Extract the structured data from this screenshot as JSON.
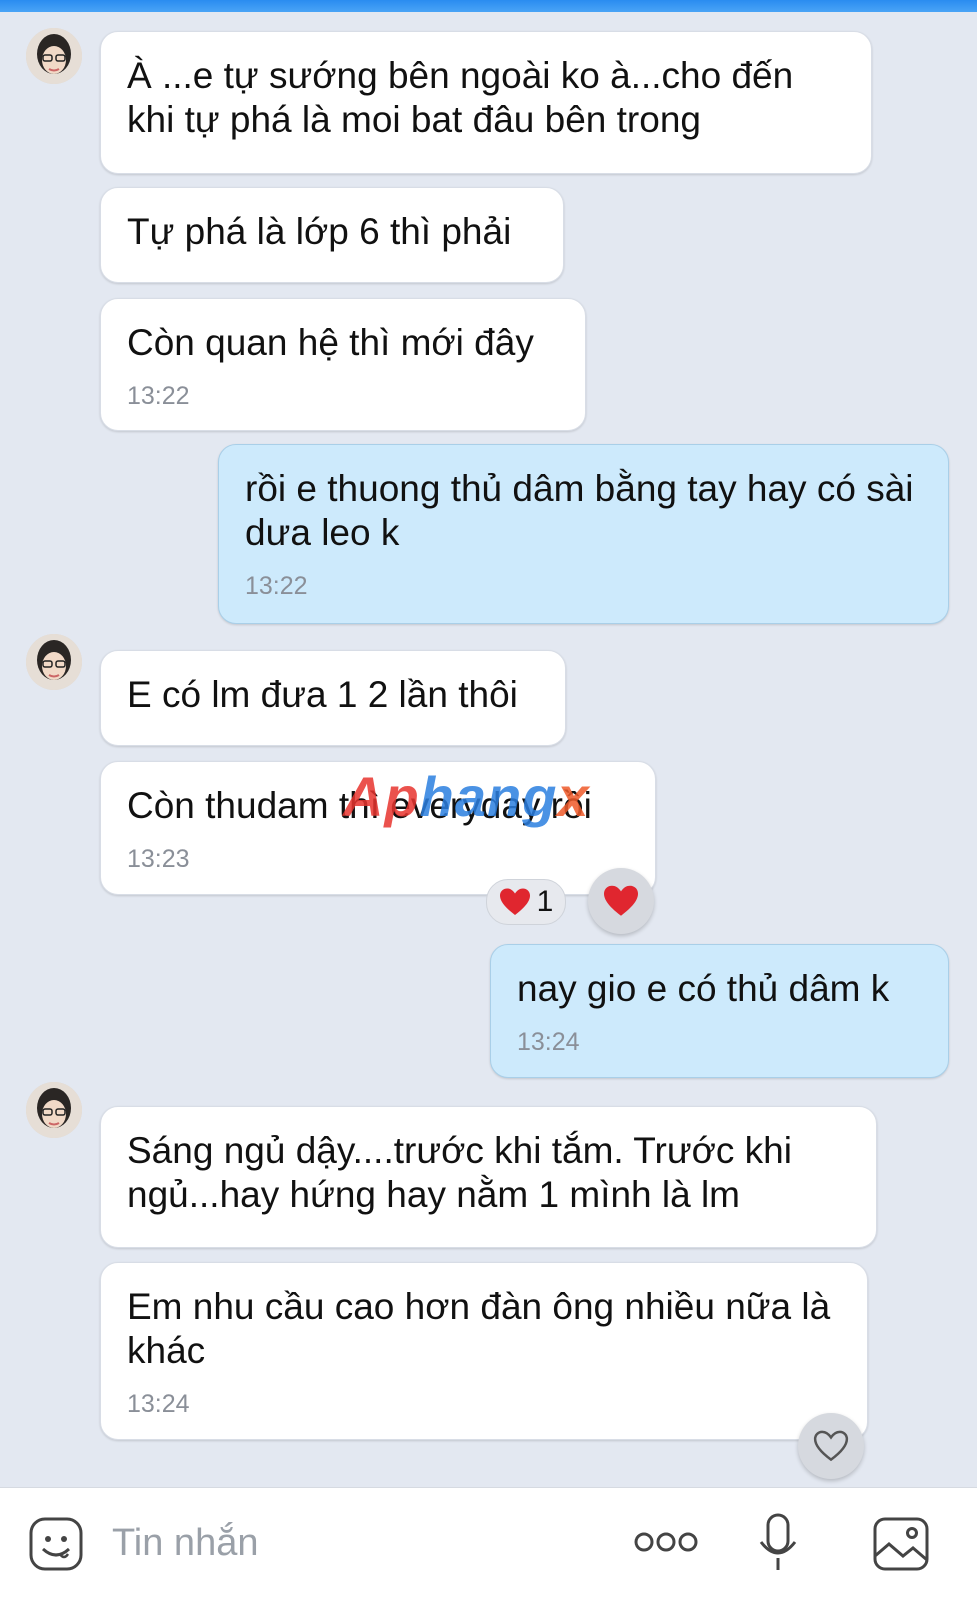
{
  "messages": [
    {
      "text": "À ...e tự sướng bên ngoài ko à...cho đến khi tự phá là moi bat đâu bên trong"
    },
    {
      "text": "Tự phá là lớp 6 thì phải"
    },
    {
      "text": "Còn quan hệ thì mới đây",
      "time": "13:22"
    },
    {
      "text": "rồi e thuong thủ dâm bằng tay hay có sài dưa leo k",
      "time": "13:22"
    },
    {
      "text": "E có lm đưa 1 2 lần thôi"
    },
    {
      "text": "Còn thudam thì everyday rồi",
      "time": "13:23",
      "reaction_count": "1"
    },
    {
      "text": "nay gio e có thủ dâm k",
      "time": "13:24"
    },
    {
      "text": "Sáng ngủ dậy....trước khi tắm.  Trước khi ngủ...hay hứng hay nằm 1 mình là lm"
    },
    {
      "text": "Em nhu cầu cao hơn đàn ông nhiều nữa là khác",
      "time": "13:24"
    }
  ],
  "watermark": {
    "part1": "Ap",
    "part2": "hang",
    "part3": "x"
  },
  "input": {
    "placeholder": "Tin nhắn"
  },
  "icons": [
    "sticker-icon",
    "more-icon",
    "microphone-icon",
    "image-icon",
    "heart-icon"
  ],
  "colors": {
    "incoming": "#ffffff",
    "outgoing": "#cdeafc",
    "background": "#e3e8f1",
    "heart": "#e0262f"
  }
}
